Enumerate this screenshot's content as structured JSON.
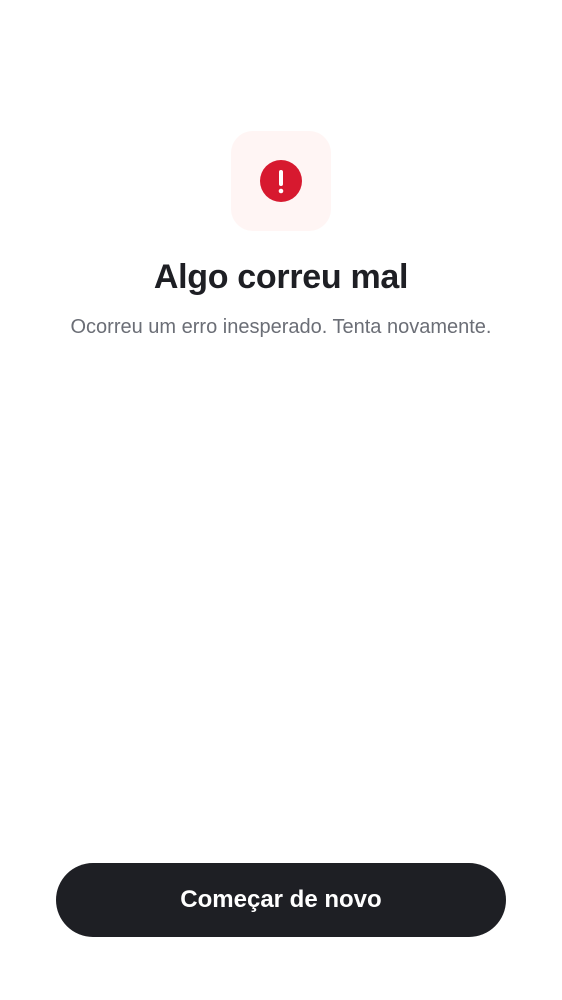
{
  "error_screen": {
    "icon": "alert-circle-icon",
    "title": "Algo correu mal",
    "message": "Ocorreu um erro inesperado. Tenta novamente."
  },
  "actions": {
    "restart_label": "Começar de novo"
  },
  "colors": {
    "background": "#FFFFFF",
    "icon_tile": "#FFF5F4",
    "error_red": "#D7192F",
    "title_text": "#1E1F24",
    "body_text": "#6B6E76",
    "button_bg": "#1E1F24",
    "button_text": "#FFFFFF"
  }
}
